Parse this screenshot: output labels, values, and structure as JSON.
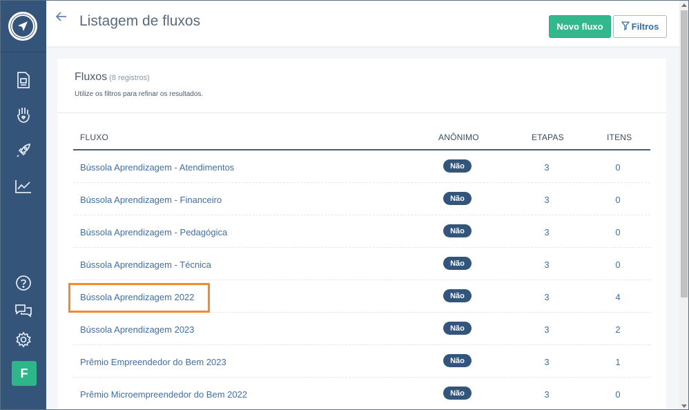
{
  "header": {
    "title": "Listagem de fluxos",
    "new_button": "Novo fluxo",
    "filter_button": "Filtros"
  },
  "card": {
    "title": "Fluxos",
    "count": "(8 registros)",
    "subtitle": "Utilize os filtros para refinar os resultados."
  },
  "table": {
    "columns": [
      "FLUXO",
      "ANÔNIMO",
      "ETAPAS",
      "ITENS"
    ],
    "rows": [
      {
        "name": "Bússola Aprendizagem - Atendimentos",
        "anon": "Não",
        "steps": "3",
        "items": "0"
      },
      {
        "name": "Bússola Aprendizagem - Financeiro",
        "anon": "Não",
        "steps": "3",
        "items": "0"
      },
      {
        "name": "Bússola Aprendizagem - Pedagógica",
        "anon": "Não",
        "steps": "3",
        "items": "0"
      },
      {
        "name": "Bússola Aprendizagem - Técnica",
        "anon": "Não",
        "steps": "3",
        "items": "0"
      },
      {
        "name": "Bússola Aprendizagem 2022",
        "anon": "Não",
        "steps": "3",
        "items": "4"
      },
      {
        "name": "Bússola Aprendizagem 2023",
        "anon": "Não",
        "steps": "3",
        "items": "2"
      },
      {
        "name": "Prêmio Empreendedor do Bem 2023",
        "anon": "Não",
        "steps": "3",
        "items": "1"
      },
      {
        "name": "Prêmio Microempreendedor do Bem 2022",
        "anon": "Não",
        "steps": "3",
        "items": "0"
      }
    ]
  },
  "sidebar": {
    "avatar_initial": "F",
    "icons": [
      "logo-icon",
      "document-icon",
      "hand-heart-icon",
      "rocket-icon",
      "chart-icon",
      "help-icon",
      "chat-icon",
      "gear-icon"
    ]
  },
  "colors": {
    "sidebar": "#34547a",
    "primary": "#33b88d",
    "link": "#3f6ea6",
    "badge": "#33557c",
    "highlight": "#f08a2e"
  }
}
